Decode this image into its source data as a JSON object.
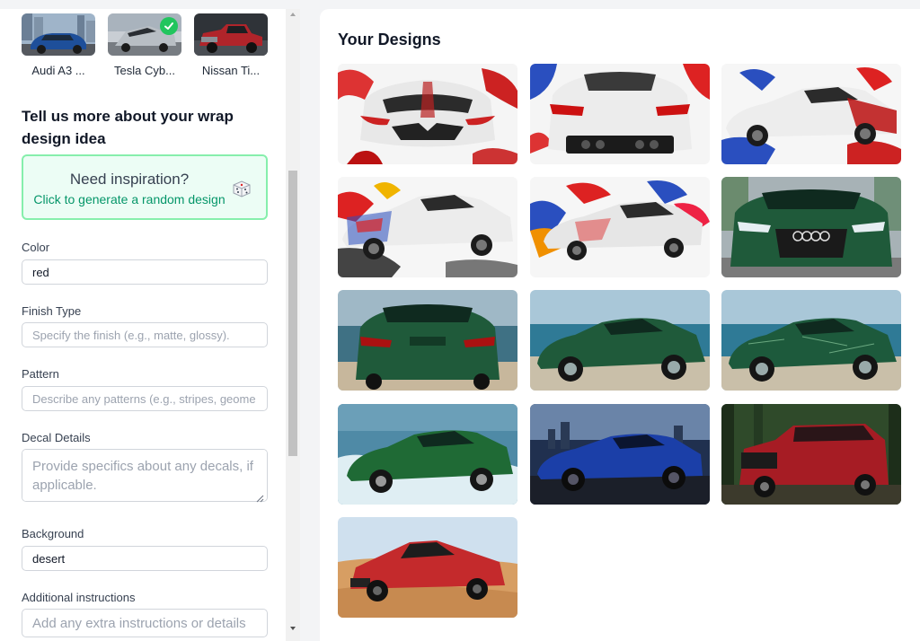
{
  "car_options": [
    {
      "label": "Audi A3 ...",
      "selected": false
    },
    {
      "label": "Tesla Cyb...",
      "selected": true
    },
    {
      "label": "Nissan Ti...",
      "selected": false
    }
  ],
  "form": {
    "section_title": "Tell us more about your wrap design idea",
    "inspiration": {
      "title": "Need inspiration?",
      "subtitle": "Click to generate a random design",
      "icon": "dice-icon"
    },
    "fields": {
      "color": {
        "label": "Color",
        "value": "red",
        "placeholder": ""
      },
      "finish": {
        "label": "Finish Type",
        "value": "",
        "placeholder": "Specify the finish (e.g., matte, glossy)."
      },
      "pattern": {
        "label": "Pattern",
        "value": "",
        "placeholder": "Describe any patterns (e.g., stripes, geome"
      },
      "decal": {
        "label": "Decal Details",
        "value": "",
        "placeholder": "Provide specifics about any decals, if applicable."
      },
      "background": {
        "label": "Background",
        "value": "desert",
        "placeholder": ""
      },
      "additional": {
        "label": "Additional instructions",
        "value": "",
        "placeholder": "Add any extra instructions or details"
      }
    }
  },
  "designs": {
    "title": "Your Designs",
    "items": [
      {
        "subject": "white corvette front with red splash"
      },
      {
        "subject": "white corvette rear with red splash"
      },
      {
        "subject": "white corvette side with red and blue splash"
      },
      {
        "subject": "white corvette side with flag splash"
      },
      {
        "subject": "white corvette with red blue paint splash"
      },
      {
        "subject": "green audi front"
      },
      {
        "subject": "green audi rear on beach"
      },
      {
        "subject": "green audi side on beach"
      },
      {
        "subject": "green audi side with pattern"
      },
      {
        "subject": "green audi in water"
      },
      {
        "subject": "blue corvette city night"
      },
      {
        "subject": "red cadillac suv forest"
      },
      {
        "subject": "red cybertruck desert"
      }
    ]
  },
  "colors": {
    "accent_green": "#22c55e",
    "inspiration_bg": "#ecfdf5",
    "inspiration_border": "#86efac",
    "inspiration_text": "#059669"
  }
}
